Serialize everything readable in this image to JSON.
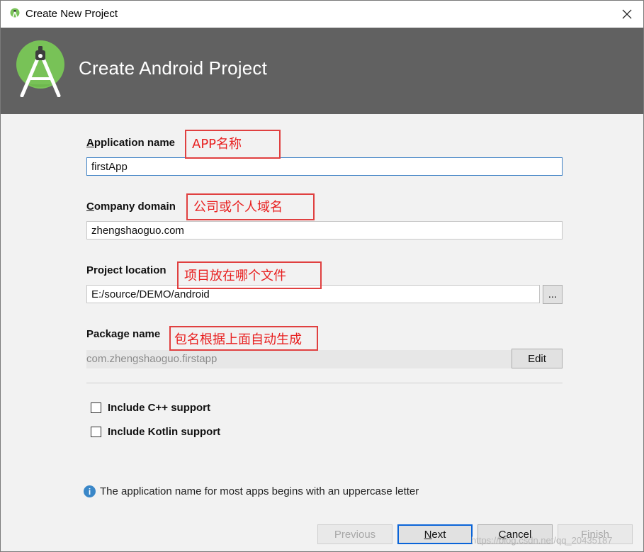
{
  "window": {
    "title": "Create New Project"
  },
  "header": {
    "title": "Create Android Project"
  },
  "form": {
    "app_name": {
      "label_first": "A",
      "label_rest": "pplication name",
      "value": "firstApp"
    },
    "company_domain": {
      "label_first": "C",
      "label_rest": "ompany domain",
      "value": "zhengshaoguo.com"
    },
    "project_location": {
      "label": "Project location",
      "value": "E:/source/DEMO/android",
      "browse_label": "..."
    },
    "package_name": {
      "label": "Package name",
      "value": "com.zhengshaoguo.firstapp",
      "edit_label": "Edit"
    }
  },
  "annotations": {
    "app_name": "APP名称",
    "company_domain": "公司或个人域名",
    "project_location": "项目放在哪个文件",
    "package_name": "包名根据上面自动生成"
  },
  "options": {
    "cpp": {
      "label": "Include C++ support",
      "checked": false
    },
    "kotlin": {
      "label": "Include Kotlin support",
      "checked": false
    }
  },
  "info": {
    "message": "The application name for most apps begins with an uppercase letter"
  },
  "buttons": {
    "previous": "Previous",
    "next_first": "N",
    "next_rest": "ext",
    "cancel_first": "C",
    "cancel_rest": "ancel",
    "finish": "Finish"
  },
  "watermark": "https://blog.csdn.net/qq_20435187",
  "colors": {
    "header_bg": "#616161",
    "android_green": "#78c257",
    "annotation_red": "#e04040",
    "focus_blue": "#3b7fc4"
  }
}
